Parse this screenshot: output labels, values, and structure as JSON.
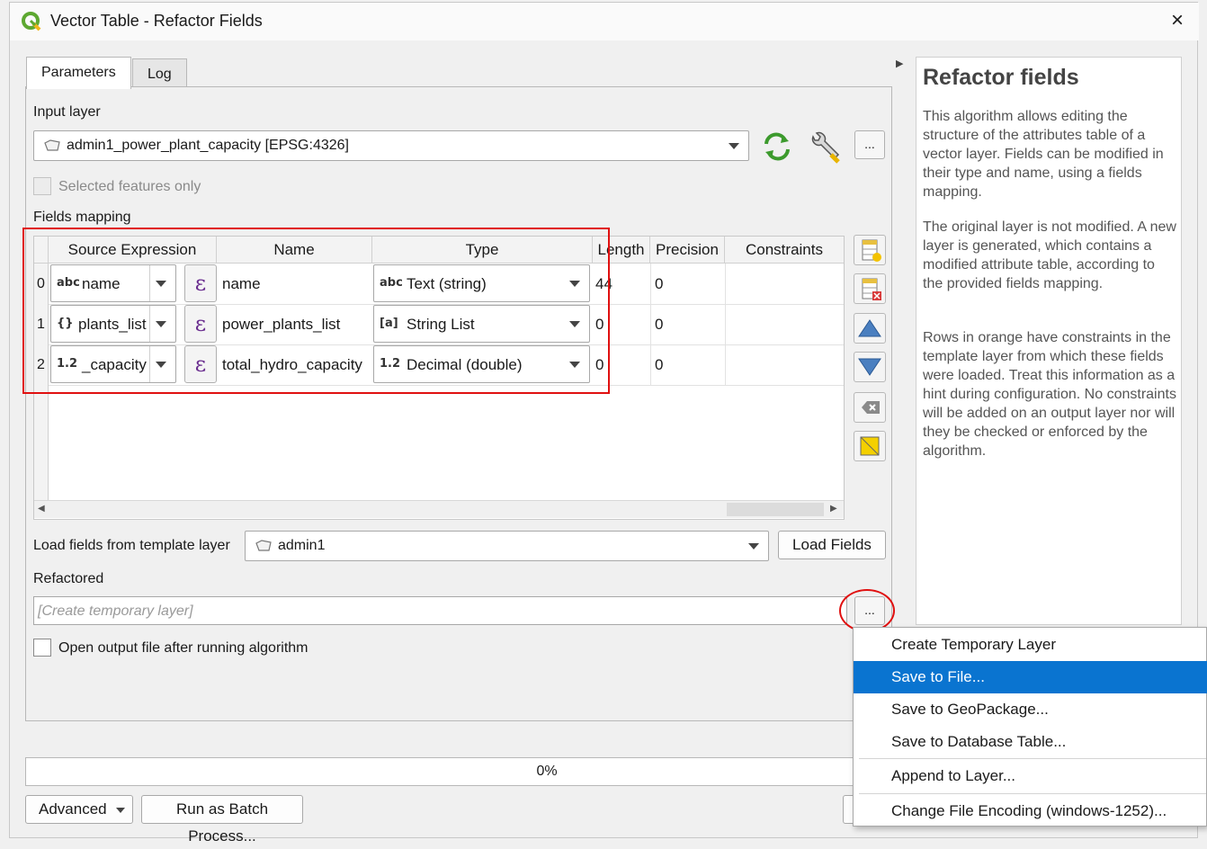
{
  "window": {
    "title": "Vector Table - Refactor Fields",
    "close_icon": "×"
  },
  "tabs": [
    {
      "label": "Parameters"
    },
    {
      "label": "Log"
    }
  ],
  "input_layer": {
    "label": "Input layer",
    "value": "admin1_power_plant_capacity [EPSG:4326]",
    "selected_only_label": "Selected features only",
    "more_label": "..."
  },
  "fields_mapping": {
    "label": "Fields mapping",
    "columns": [
      "Source Expression",
      "Name",
      "Type",
      "Length",
      "Precision",
      "Constraints"
    ],
    "rows": [
      {
        "index": "0",
        "src_icon": "abc",
        "src_text": "name",
        "name": "name",
        "type_icon": "abc",
        "type": "Text (string)",
        "length": "44",
        "precision": "0",
        "constraints": ""
      },
      {
        "index": "1",
        "src_icon": "{}",
        "src_text": "plants_list",
        "name": "power_plants_list",
        "type_icon": "[a]",
        "type": "String List",
        "length": "0",
        "precision": "0",
        "constraints": ""
      },
      {
        "index": "2",
        "src_icon": "1.2",
        "src_text": "_capacity",
        "name": "total_hydro_capacity",
        "type_icon": "1.2",
        "type": "Decimal (double)",
        "length": "0",
        "precision": "0",
        "constraints": ""
      }
    ],
    "expression_glyph": "ε"
  },
  "template": {
    "label": "Load fields from template layer",
    "value": "admin1",
    "button": "Load Fields"
  },
  "refactored": {
    "label": "Refactored",
    "placeholder": "[Create temporary layer]",
    "more_label": "...",
    "open_output_label": "Open output file after running algorithm"
  },
  "progress": {
    "text": "0%"
  },
  "bottom": {
    "advanced": "Advanced",
    "batch": "Run as Batch Process..."
  },
  "help": {
    "title": "Refactor fields",
    "paragraphs": [
      "This algorithm allows editing the structure of the attributes table of a vector layer. Fields can be modified in their type and name, using a fields mapping.",
      "The original layer is not modified. A new layer is generated, which contains a modified attribute table, according to the provided fields mapping.",
      "Rows in orange have constraints in the template layer from which these fields were loaded. Treat this information as a hint during configuration. No constraints will be added on an output layer nor will they be checked or enforced by the algorithm."
    ]
  },
  "menu": {
    "items": [
      "Create Temporary Layer",
      "Save to File...",
      "Save to GeoPackage...",
      "Save to Database Table...",
      "Append to Layer...",
      "Change File Encoding (windows-1252)..."
    ],
    "selected": "Save to File..."
  },
  "colors": {
    "highlight": "#0a74d0",
    "annotation": "#e01010"
  }
}
